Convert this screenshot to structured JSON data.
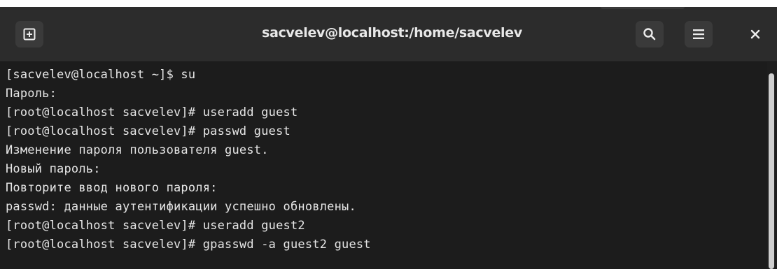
{
  "window": {
    "title": "sacvelev@localhost:/home/sacvelev"
  },
  "icons": {
    "new_tab": "new-tab-icon",
    "search": "search-icon",
    "menu": "hamburger-menu-icon",
    "close": "close-icon"
  },
  "terminal": {
    "lines": [
      "[sacvelev@localhost ~]$ su",
      "Пароль:",
      "[root@localhost sacvelev]# useradd guest",
      "[root@localhost sacvelev]# passwd guest",
      "Изменение пароля пользователя guest.",
      "Новый пароль:",
      "Повторите ввод нового пароля:",
      "passwd: данные аутентификации успешно обновлены.",
      "[root@localhost sacvelev]# useradd guest2",
      "[root@localhost sacvelev]# gpasswd -a guest2 guest"
    ]
  },
  "colors": {
    "titlebar": "#2c2c2c",
    "terminal_bg": "#1c1c1c",
    "text": "#e6e6e6"
  }
}
